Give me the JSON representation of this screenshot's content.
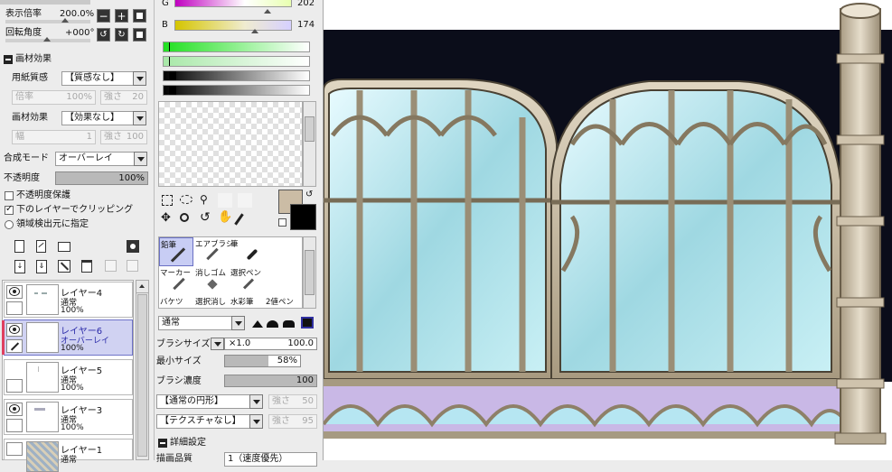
{
  "nav": {
    "display_ratio_label": "表示倍率",
    "display_ratio_value": "200.0%",
    "rotation_label": "回転角度",
    "rotation_value": "+000°"
  },
  "brush_effect": {
    "section_title": "画材効果",
    "paper_label": "用紙質感",
    "paper_value": "【質感なし】",
    "paper_rate_label": "倍率",
    "paper_rate_value": "100%",
    "paper_strength_label": "強さ",
    "paper_strength_value": "20",
    "material_label": "画材効果",
    "material_value": "【効果なし】",
    "material_width_label": "幅",
    "material_width_value": "1",
    "material_strength_label": "強さ",
    "material_strength_value": "100"
  },
  "layer_props": {
    "blend_label": "合成モード",
    "blend_value": "オーバーレイ",
    "opacity_label": "不透明度",
    "opacity_value": "100%",
    "opacity_fraction": 1.0,
    "preserve_opacity_label": "不透明度保護",
    "clip_label": "下のレイヤーでクリッピング",
    "clip_checked": true,
    "region_label": "領域検出元に指定"
  },
  "layers": [
    {
      "name": "レイヤー4",
      "mode": "通常",
      "opacity": "100%"
    },
    {
      "name": "レイヤー6",
      "mode": "オーバーレイ",
      "opacity": "100%"
    },
    {
      "name": "レイヤー5",
      "mode": "通常",
      "opacity": "100%"
    },
    {
      "name": "レイヤー3",
      "mode": "通常",
      "opacity": "100%"
    },
    {
      "name": "レイヤー1",
      "mode": "通常",
      "opacity": ""
    }
  ],
  "color": {
    "g_label": "G",
    "g_value": "202",
    "b_label": "B",
    "b_value": "174",
    "primary": "#cbbca5",
    "secondary": "#000000"
  },
  "tools": {
    "cells": [
      "鉛筆",
      "エアブラシ",
      "筆",
      "マーカー",
      "消しゴム",
      "選択ペン",
      "バケツ",
      "選択消し",
      "水彩筆",
      "2値ペン"
    ]
  },
  "brush": {
    "mode_value": "通常",
    "size_label": "ブラシサイズ",
    "size_multiplier": "×1.0",
    "size_value": "100.0",
    "min_size_label": "最小サイズ",
    "min_size_value": "58%",
    "min_size_fraction": 0.58,
    "density_label": "ブラシ濃度",
    "density_value": "100",
    "density_fraction": 1.0,
    "shape_value": "【通常の円形】",
    "shape_strength_label": "強さ",
    "shape_strength_value": "50",
    "texture_value": "【テクスチャなし】",
    "texture_strength_label": "強さ",
    "texture_strength_value": "95",
    "detail_label": "詳細設定",
    "quality_label": "描画品質",
    "quality_value": "1（速度優先）"
  }
}
